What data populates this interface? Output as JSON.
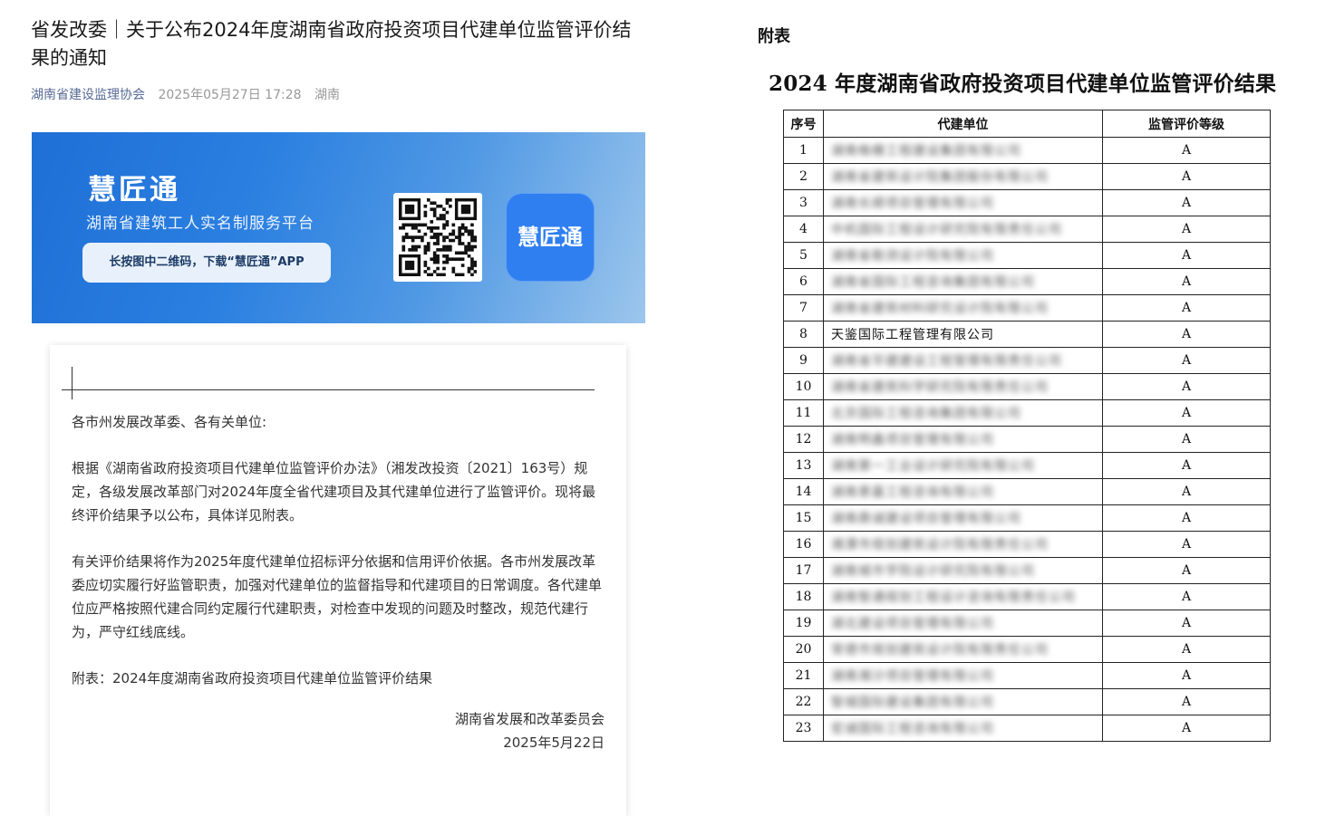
{
  "article": {
    "title": "省发改委｜关于公布2024年度湖南省政府投资项目代建单位监管评价结果的通知",
    "author": "湖南省建设监理协会",
    "date": "2025年05月27日 17:28",
    "location": "湖南"
  },
  "banner": {
    "brand": "慧匠通",
    "subtitle": "湖南省建筑工人实名制服务平台",
    "cta": "长按图中二维码，下载“慧匠通”APP",
    "app_icon_text": "慧匠通",
    "colors": {
      "bg_start": "#1f6fd6",
      "bg_end": "#9cc6ec",
      "icon": "#2f7ff0"
    }
  },
  "notice": {
    "greeting": "各市州发展改革委、各有关单位:",
    "para1": "根据《湖南省政府投资项目代建单位监管评价办法》（湘发改投资〔2021〕163号）规定，各级发展改革部门对2024年度全省代建项目及其代建单位进行了监管评价。现将最终评价结果予以公布，具体详见附表。",
    "para2": "有关评价结果将作为2025年度代建单位招标评分依据和信用评价依据。各市州发展改革委应切实履行好监管职责，加强对代建单位的监督指导和代建项目的日常调度。各代建单位应严格按照代建合同约定履行代建职责，对检查中发现的问题及时整改，规范代建行为，严守红线底线。",
    "attachment": "附表：2024年度湖南省政府投资项目代建单位监管评价结果",
    "signer": "湖南省发展和改革委员会",
    "sign_date": "2025年5月22日"
  },
  "appendix": {
    "label": "附表",
    "title": "2024 年度湖南省政府投资项目代建单位监管评价结果",
    "headers": [
      "序号",
      "代建单位",
      "监管评价等级"
    ],
    "rows": [
      {
        "no": "1",
        "org": "湖南格栅工程建设集团有限公司",
        "blurred": true,
        "grade": "A"
      },
      {
        "no": "2",
        "org": "湖南省建筑设计院集团股份有限公司",
        "blurred": true,
        "grade": "A"
      },
      {
        "no": "3",
        "org": "湖南长顺项目管理有限公司",
        "blurred": true,
        "grade": "A"
      },
      {
        "no": "4",
        "org": "中机国际工程设计研究院有限责任公司",
        "blurred": true,
        "grade": "A"
      },
      {
        "no": "5",
        "org": "湖南省勘测设计院有限公司",
        "blurred": true,
        "grade": "A"
      },
      {
        "no": "6",
        "org": "湖南省国际工程咨询集团有限公司",
        "blurred": true,
        "grade": "A"
      },
      {
        "no": "7",
        "org": "湖南省建筑材料研究设计院有限公司",
        "blurred": true,
        "grade": "A"
      },
      {
        "no": "8",
        "org": "天鉴国际工程管理有限公司",
        "blurred": false,
        "grade": "A"
      },
      {
        "no": "9",
        "org": "湖南省华建建设工程管理有限责任公司",
        "blurred": true,
        "grade": "A"
      },
      {
        "no": "10",
        "org": "湖南省建筑科学研究院有限责任公司",
        "blurred": true,
        "grade": "A"
      },
      {
        "no": "11",
        "org": "北京国际工程咨询集团有限公司",
        "blurred": true,
        "grade": "A"
      },
      {
        "no": "12",
        "org": "湖南明鑫项目管理有限公司",
        "blurred": true,
        "grade": "A"
      },
      {
        "no": "13",
        "org": "湖南第一工业设计研究院有限公司",
        "blurred": true,
        "grade": "A"
      },
      {
        "no": "14",
        "org": "湖南景嘉工程咨询有限公司",
        "blurred": true,
        "grade": "A"
      },
      {
        "no": "15",
        "org": "湖南鼎诚建设项目管理有限公司",
        "blurred": true,
        "grade": "A"
      },
      {
        "no": "16",
        "org": "湘潭市规划建筑设计院有限责任公司",
        "blurred": true,
        "grade": "A"
      },
      {
        "no": "17",
        "org": "湖南城市学院设计研究院有限公司",
        "blurred": true,
        "grade": "A"
      },
      {
        "no": "18",
        "org": "湖南智通规划工程设计咨询有限责任公司",
        "blurred": true,
        "grade": "A"
      },
      {
        "no": "19",
        "org": "湖北建设项目管理有限公司",
        "blurred": true,
        "grade": "A"
      },
      {
        "no": "20",
        "org": "常德市规划建筑设计院有限责任公司",
        "blurred": true,
        "grade": "A"
      },
      {
        "no": "21",
        "org": "湖南湘沙项目管理有限公司",
        "blurred": true,
        "grade": "A"
      },
      {
        "no": "22",
        "org": "智城国际建设集团有限公司",
        "blurred": true,
        "grade": "A"
      },
      {
        "no": "23",
        "org": "宏诚国际工程咨询有限公司",
        "blurred": true,
        "grade": "A"
      }
    ]
  }
}
